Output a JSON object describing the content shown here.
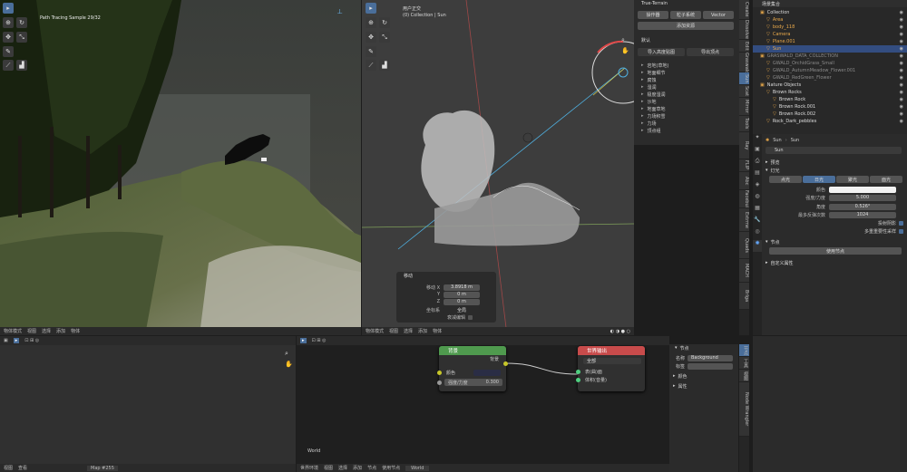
{
  "render_view": {
    "sample_text": "Path Tracing Sample 29/32",
    "menu": [
      "物体模式",
      "视图",
      "选择",
      "添加",
      "物体"
    ]
  },
  "viewport3d": {
    "title": "用户正交",
    "collection": "(0) Collection | Sun",
    "menu": [
      "物体模式",
      "视图",
      "选择",
      "添加",
      "物体"
    ]
  },
  "n_panel": {
    "header": "True-Terrain",
    "tabs": [
      "操作器",
      "粒子系统",
      "Vector"
    ],
    "button": "添加资源",
    "section": "默认",
    "sub_buttons": [
      "导入高度贴图",
      "导出顶点"
    ],
    "items": [
      "岩地(草地)",
      "地面细节",
      "腐蚀",
      "湿润",
      "极度湿润",
      "沙地",
      "地面草地",
      "力场积雪",
      "力场",
      "顶点组"
    ]
  },
  "operator_panel": {
    "title": "移动",
    "x_label": "移动 X",
    "x_value": "3.8918 m",
    "y_label": "Y",
    "y_value": "0 m",
    "z_label": "Z",
    "z_value": "0 m",
    "orient_label": "坐标系",
    "orient_value": "全局",
    "proportional": "衰减编辑"
  },
  "outliner": {
    "header": "场景集合",
    "items": [
      {
        "name": "Collection",
        "indent": 0,
        "color": "#ddd"
      },
      {
        "name": "Area",
        "indent": 1,
        "color": "#e8a84a"
      },
      {
        "name": "body_118",
        "indent": 1,
        "color": "#e8a84a"
      },
      {
        "name": "Camera",
        "indent": 1,
        "color": "#e8a84a"
      },
      {
        "name": "Plane.001",
        "indent": 1,
        "color": "#e8a84a"
      },
      {
        "name": "Sun",
        "indent": 1,
        "color": "#e8a84a",
        "selected": true
      },
      {
        "name": "GRASWALD_DATA_COLLECTION",
        "indent": 0,
        "color": "#8a8a8a"
      },
      {
        "name": "GWALD_OrchidGrass_Small",
        "indent": 1,
        "color": "#8a8a8a"
      },
      {
        "name": "GWALD_AutumnMeadow_Flower.001",
        "indent": 1,
        "color": "#8a8a8a"
      },
      {
        "name": "GWALD_RedGreen_Flower",
        "indent": 1,
        "color": "#8a8a8a"
      },
      {
        "name": "Nature Objects",
        "indent": 0,
        "color": "#ddd"
      },
      {
        "name": "Brown Rocks",
        "indent": 1,
        "color": "#ddd"
      },
      {
        "name": "Brown Rock",
        "indent": 2,
        "color": "#ddd"
      },
      {
        "name": "Brown Rock.001",
        "indent": 2,
        "color": "#ddd"
      },
      {
        "name": "Brown Rock.002",
        "indent": 2,
        "color": "#ddd"
      },
      {
        "name": "Rock_Dark_pebbles",
        "indent": 1,
        "color": "#ddd"
      }
    ]
  },
  "properties": {
    "breadcrumb_obj": "Sun",
    "breadcrumb_data": "Sun",
    "datablock": "Sun",
    "section_preview": "预览",
    "section_light": "灯光",
    "light_types": [
      "点光",
      "日光",
      "聚光",
      "面光"
    ],
    "rows": [
      {
        "label": "颜色",
        "value": ""
      },
      {
        "label": "强度/力度",
        "value": "5.000"
      },
      {
        "label": "角度",
        "value": "0.526°"
      },
      {
        "label": "最多反弹次数",
        "value": "1024"
      }
    ],
    "checkboxes": [
      "投射阴影",
      "多重重要性采样"
    ],
    "section_nodes": "节点",
    "use_nodes": "使用节点",
    "section_custom": "自定义属性",
    "vtabs": [
      "工具",
      "渲染",
      "输出",
      "视图层",
      "场景",
      "世界",
      "物体",
      "修改器",
      "粒子",
      "物理",
      "约束",
      "数据"
    ],
    "left_tabs": [
      "Create",
      "Dissolve",
      "Edit",
      "Graswald",
      "Sun",
      "Scat",
      "Mirror",
      "Tools",
      "Ray",
      "FLIP",
      "Abc",
      "Facebui",
      "Extrme",
      "Quads",
      "MACH",
      "Brlga"
    ]
  },
  "left_bottom": {
    "menu": [
      "视图",
      "查看",
      "Map #255"
    ]
  },
  "node_editor": {
    "menu": [
      "世界环境",
      "视图",
      "选择",
      "添加",
      "节点",
      "使用节点"
    ],
    "world_name": "World",
    "label": "World",
    "bg_node": {
      "title": "背景",
      "output": "背景",
      "color_label": "颜色",
      "strength_label": "强度/力度",
      "strength_value": "0.300"
    },
    "out_node": {
      "title": "世界输出",
      "target": "全部",
      "surface": "表(曲)面",
      "volume": "体积(音量)"
    },
    "side": {
      "section": "节点",
      "name_label": "名称",
      "name_value": "Background",
      "label_label": "标签",
      "color_label": "颜色",
      "props_label": "属性",
      "tabs": [
        "节点",
        "工具",
        "视图",
        "Node Wrangler"
      ]
    }
  },
  "colors": {
    "bg_node_header": "#4f9a4e",
    "out_node_header": "#c84b4b",
    "selected": "#334d80",
    "accent": "#4a6e9a"
  }
}
